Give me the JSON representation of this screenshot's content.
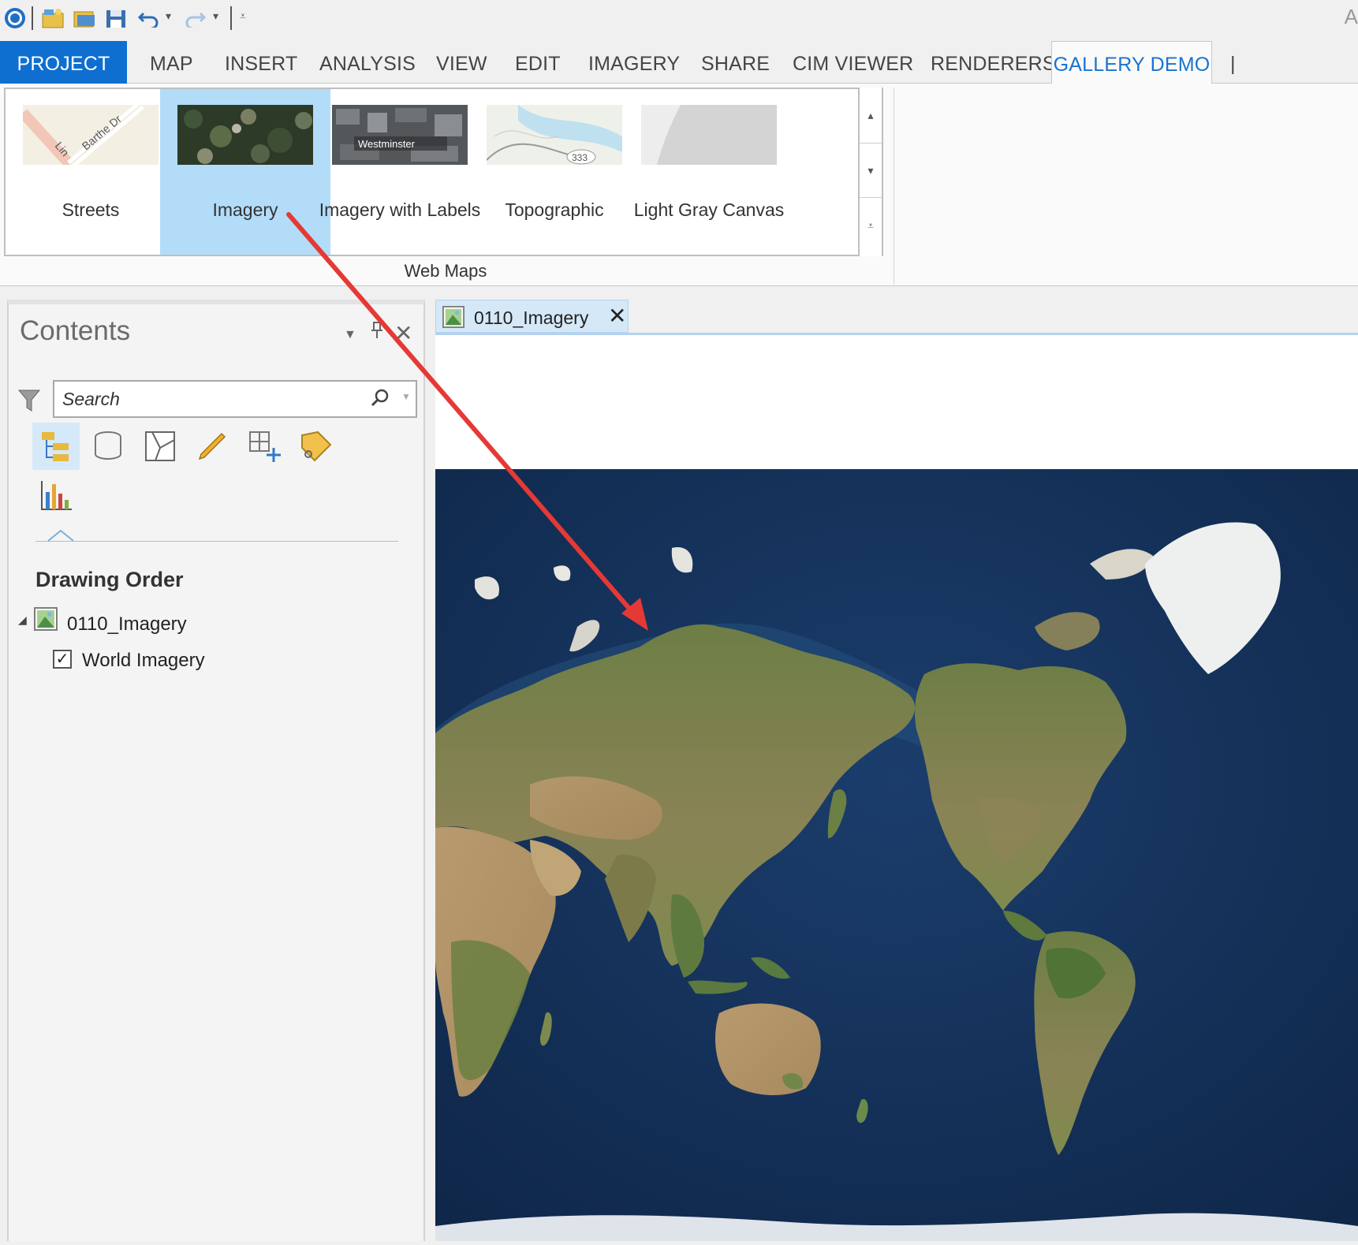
{
  "window": {
    "title_fragment": "A"
  },
  "ribbon": {
    "tabs": [
      {
        "label": "PROJECT"
      },
      {
        "label": "MAP"
      },
      {
        "label": "INSERT"
      },
      {
        "label": "ANALYSIS"
      },
      {
        "label": "VIEW"
      },
      {
        "label": "EDIT"
      },
      {
        "label": "IMAGERY"
      },
      {
        "label": "SHARE"
      },
      {
        "label": "CIM VIEWER"
      },
      {
        "label": "RENDERERS"
      },
      {
        "label": "GALLERY DEMO"
      }
    ],
    "active_tab": "GALLERY DEMO",
    "gallery": {
      "group_label": "Web Maps",
      "selected": "Imagery",
      "items": [
        {
          "label": "Streets",
          "thumb_labels": [
            "Barthe Dr",
            "Lin"
          ]
        },
        {
          "label": "Imagery"
        },
        {
          "label": "Imagery with Labels",
          "thumb_labels": [
            "Westminster"
          ]
        },
        {
          "label": "Topographic",
          "thumb_labels": [
            "333"
          ]
        },
        {
          "label": "Light Gray Canvas"
        }
      ]
    }
  },
  "contents": {
    "title": "Contents",
    "search_placeholder": "Search",
    "section_title": "Drawing Order",
    "map_node": "0110_Imagery",
    "layers": [
      {
        "label": "World Imagery",
        "checked": true
      }
    ]
  },
  "map_view": {
    "tab_label": "0110_Imagery"
  },
  "colors": {
    "accent": "#0e6fd0",
    "active_tab_text": "#1a73d1",
    "gallery_selected": "#b3dcf9",
    "annotation_arrow": "#e53935",
    "ocean": "#14305a"
  },
  "icons": [
    "arcgis-pro-icon",
    "new-project-icon",
    "open-project-icon",
    "save-project-icon",
    "undo-icon",
    "redo-icon",
    "customize-icon",
    "filter-icon",
    "search-icon",
    "list-by-drawing-order-icon",
    "list-by-source-icon",
    "list-by-selection-icon",
    "list-by-editing-icon",
    "list-by-snapping-icon",
    "list-by-labeling-icon",
    "list-by-charts-icon",
    "map-icon",
    "pin-icon",
    "close-icon"
  ]
}
